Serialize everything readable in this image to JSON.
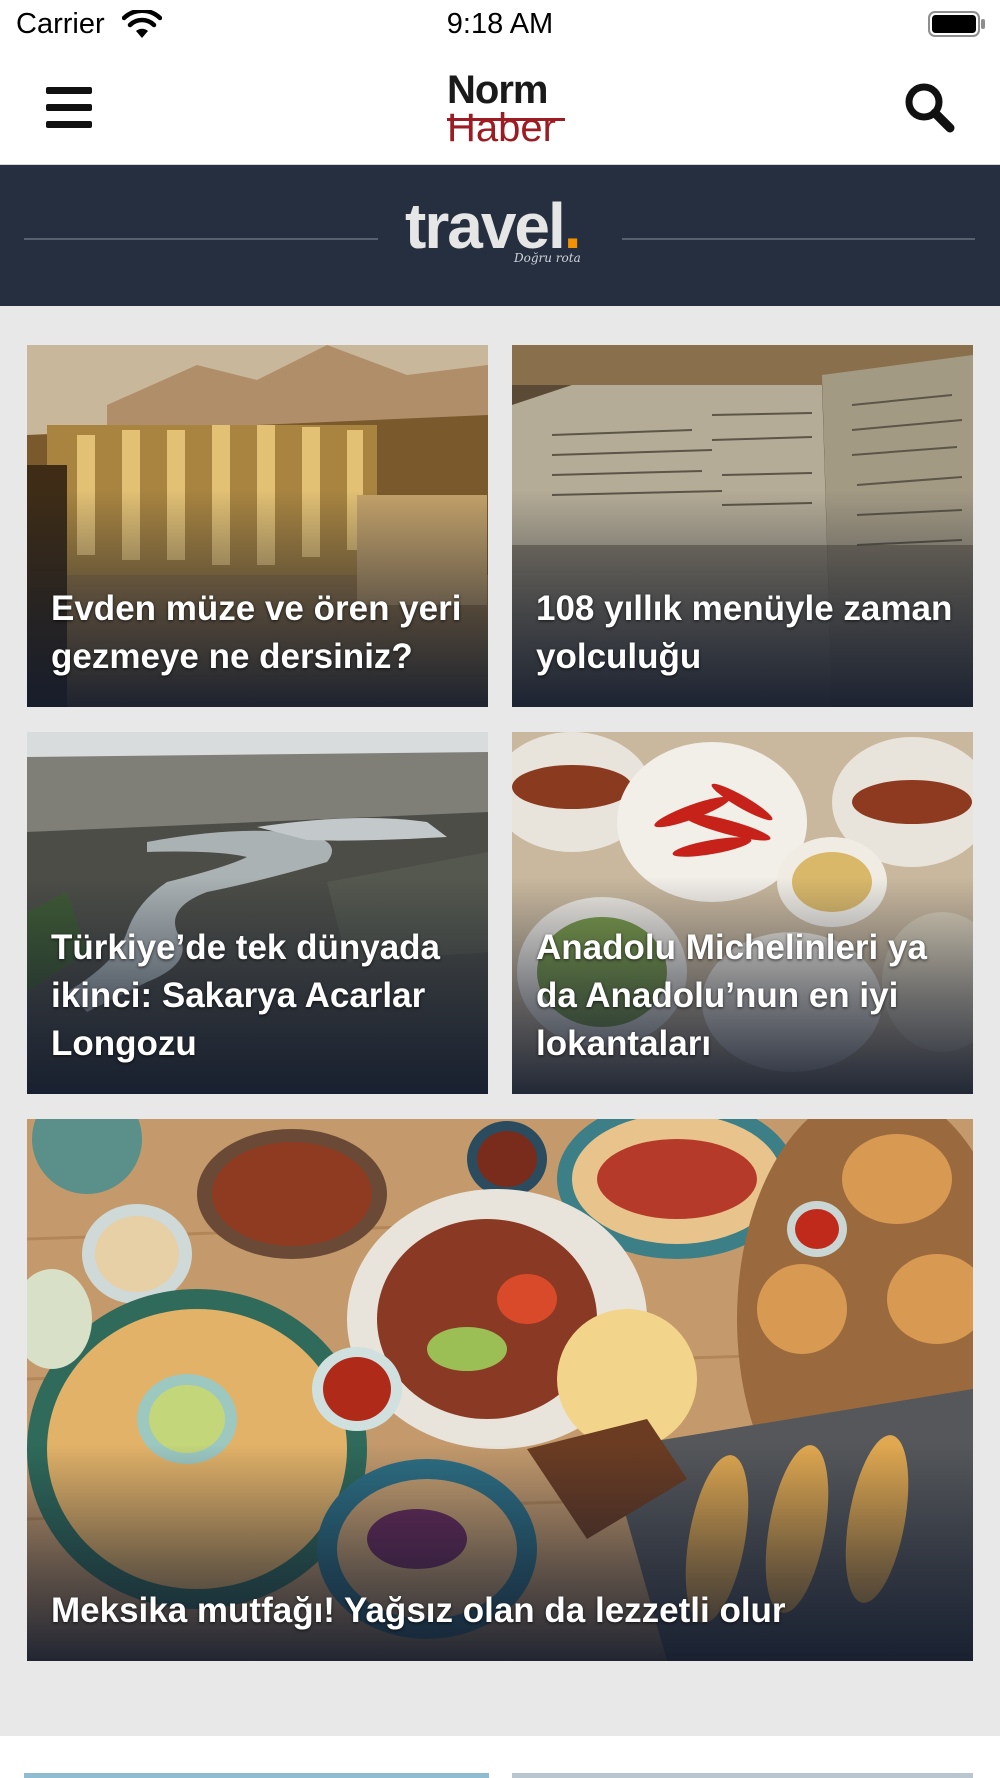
{
  "status_bar": {
    "carrier": "Carrier",
    "time": "9:18 AM"
  },
  "header": {
    "menu_icon": "hamburger-menu-icon",
    "logo_line1": "Norm",
    "logo_line2": "Haber",
    "search_icon": "search-icon",
    "brand_color": "#9c1c23"
  },
  "banner": {
    "title": "travel",
    "dot": ".",
    "tagline": "Doğru rota",
    "background": "#262f40",
    "accent": "#f39200"
  },
  "articles": [
    {
      "title": "Evden müze ve ören yeri gezmeye ne dersiniz?"
    },
    {
      "title": "108 yıllık menüyle zaman yolculuğu"
    },
    {
      "title": "Türkiye’de tek dünyada ikinci: Sakarya Acarlar Longozu"
    },
    {
      "title": "Anadolu Michelinleri ya da Anadolu’nun en iyi lokantaları"
    },
    {
      "title": "Meksika mutfağı! Yağsız olan da lezzetli olur"
    }
  ]
}
